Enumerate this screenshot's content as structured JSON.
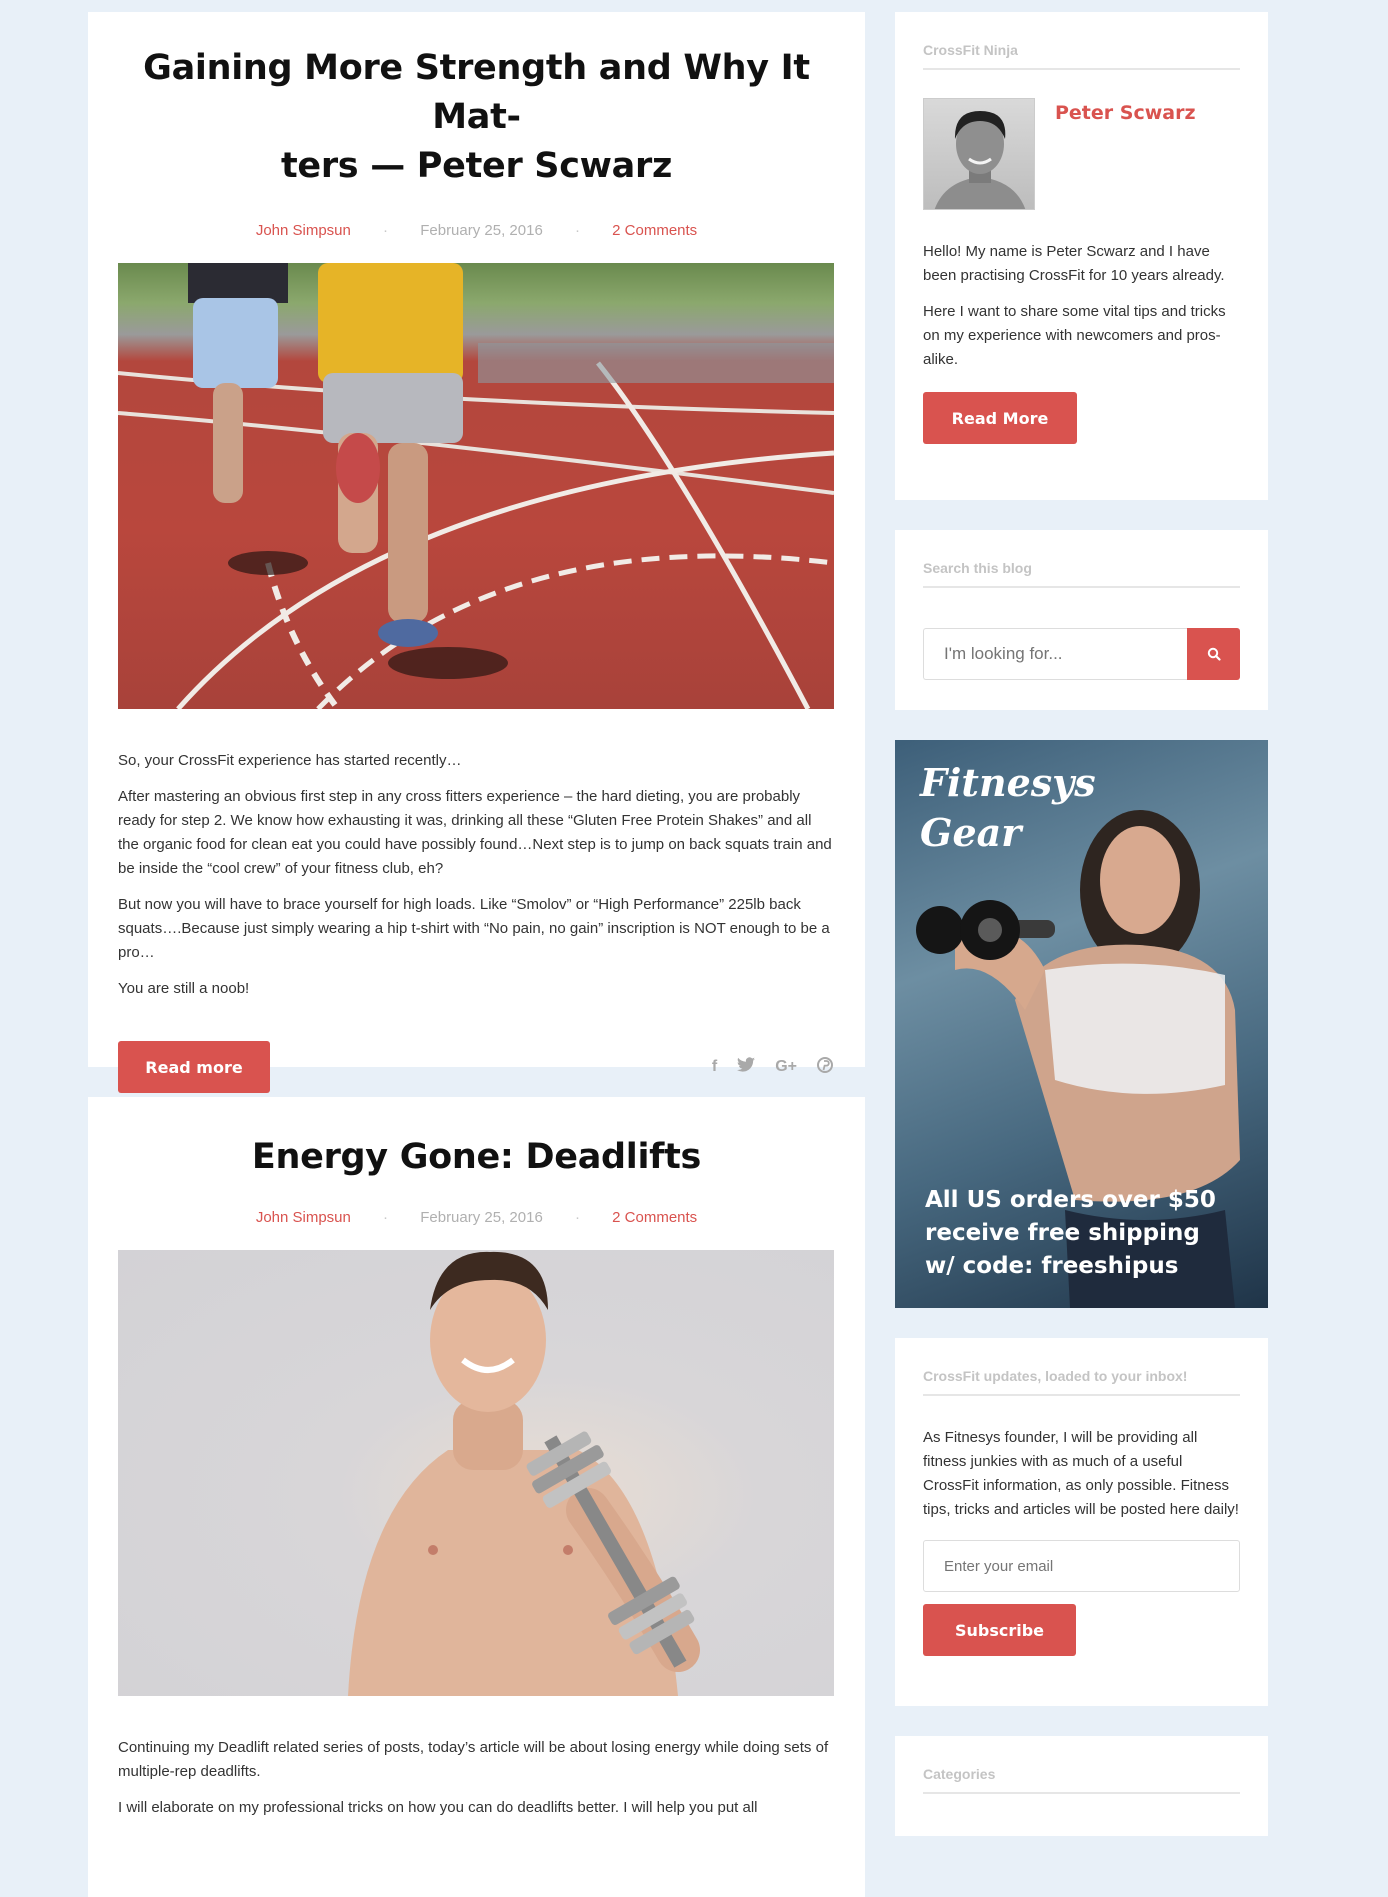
{
  "posts": [
    {
      "title": "Gaining More Strength and Why It Mat-ters — Peter Scwarz",
      "title_line1": "Gaining More Strength and Why It Mat-",
      "title_line2": "ters — Peter Scwarz",
      "author": "John Simpsun",
      "date": "February 25, 2016",
      "comments": "2 Comments",
      "separator": "·",
      "paragraphs": [
        "So, your CrossFit experience has started recently…",
        "After mastering an obvious first step in any cross fitters experience – the hard dieting, you are probably ready for step 2. We know how exhausting it was, drinking all these “Gluten Free Protein Shakes” and all the organic food for clean eat you could have possibly found…Next step is to jump on back squats train and be inside the “cool crew” of your fitness club, eh?",
        "But now you will have to brace yourself for high loads. Like “Smolov” or “High Performance” 225lb back squats….Because just simply wearing a hip t-shirt with “No pain, no gain” inscription is NOT enough to be a pro…",
        "You are still a noob!"
      ],
      "read_more": "Read more",
      "share_icons": [
        "facebook-icon",
        "twitter-icon",
        "google-plus-icon",
        "pinterest-icon"
      ]
    },
    {
      "title": "Energy Gone: Deadlifts",
      "author": "John Simpsun",
      "date": "February 25, 2016",
      "comments": "2 Comments",
      "separator": "·",
      "paragraphs": [
        "Continuing my Deadlift related series of posts, today’s article will be about losing energy while doing sets of multiple-rep deadlifts.",
        "I will elaborate on my professional tricks on how you can do deadlifts better. I will help you put all"
      ]
    }
  ],
  "sidebar": {
    "author_widget": {
      "title": "CrossFit Ninja",
      "name": "Peter Scwarz",
      "paragraphs": [
        "Hello! My name is Peter Scwarz and I have been practising CrossFit for 10 years already.",
        "Here I want to share some vital tips and tricks on my experience with newcomers and pros-alike."
      ],
      "button": "Read More"
    },
    "search_widget": {
      "title": "Search this blog",
      "placeholder": "I'm looking for...",
      "button_icon": "search-icon"
    },
    "ad": {
      "title_line1": "Fitnesys",
      "title_line2": "Gear",
      "text_line1": "All US orders over $50",
      "text_line2": "receive free shipping",
      "text_line3": "w/ code: freeshipus"
    },
    "subscribe_widget": {
      "title": "CrossFit updates, loaded to your inbox!",
      "text": "As Fitnesys founder, I will be providing all fitness junkies with as much of a useful CrossFit information, as only possible. Fitness tips, tricks and articles will be posted here daily!",
      "placeholder": "Enter your email",
      "button": "Subscribe"
    },
    "categories_widget": {
      "title": "Categories"
    }
  },
  "colors": {
    "accent": "#d9534f",
    "background": "#e8f0f8",
    "muted": "#b0b0b0"
  }
}
